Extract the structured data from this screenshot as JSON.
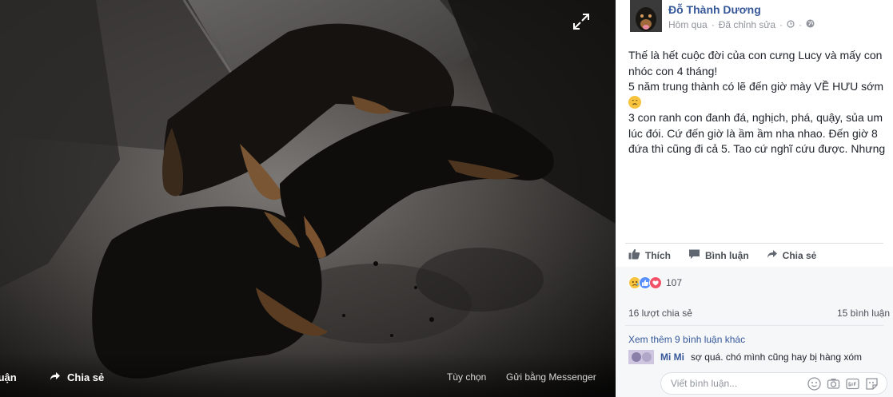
{
  "photo_bar": {
    "comment_label": "luận",
    "share_label": "Chia sẻ",
    "options_label": "Tùy chọn",
    "messenger_label": "Gửi bằng Messenger"
  },
  "post": {
    "author": "Đỗ Thành Dương",
    "time": "Hôm qua",
    "edited": "Đã chỉnh sửa",
    "text_lines": [
      "Thế là hết cuộc đời của con cưng Lucy và mấy con nhóc con 4 tháng!",
      "5 năm trung thành có lẽ đến giờ mày VỀ HƯU sớm",
      "3 con ranh con đanh đá, nghịch, phá, quậy, sủa um lúc đói. Cứ đến giờ là ầm ầm nha nhao. Đến giờ 8 đứa thì cũng đi cả 5. Tao cứ nghĩ cứu được. Nhưng"
    ]
  },
  "actions": {
    "like": "Thích",
    "comment": "Bình luận",
    "share": "Chia sẻ"
  },
  "stats": {
    "reaction_count": "107",
    "shares": "16 lượt chia sẻ",
    "comments": "15 bình luận"
  },
  "comments": {
    "more": "Xem thêm 9 bình luận khác",
    "first": {
      "name": "Mi Mi",
      "text": "sợ quá. chó mình cũng hay bị hàng xóm"
    },
    "input_placeholder": "Viết bình luận..."
  },
  "colors": {
    "link": "#365899",
    "muted": "#90949c",
    "like_blue": "#5890ff",
    "love_red": "#f25268",
    "haha_yellow": "#f7c23d"
  },
  "icons": [
    "expand-icon",
    "share-arrow-icon",
    "globe-icon",
    "like-icon",
    "comment-icon",
    "sad-reaction-icon",
    "like-reaction-icon",
    "love-reaction-icon",
    "emoji-icon",
    "camera-icon",
    "gif-icon",
    "sticker-icon"
  ]
}
